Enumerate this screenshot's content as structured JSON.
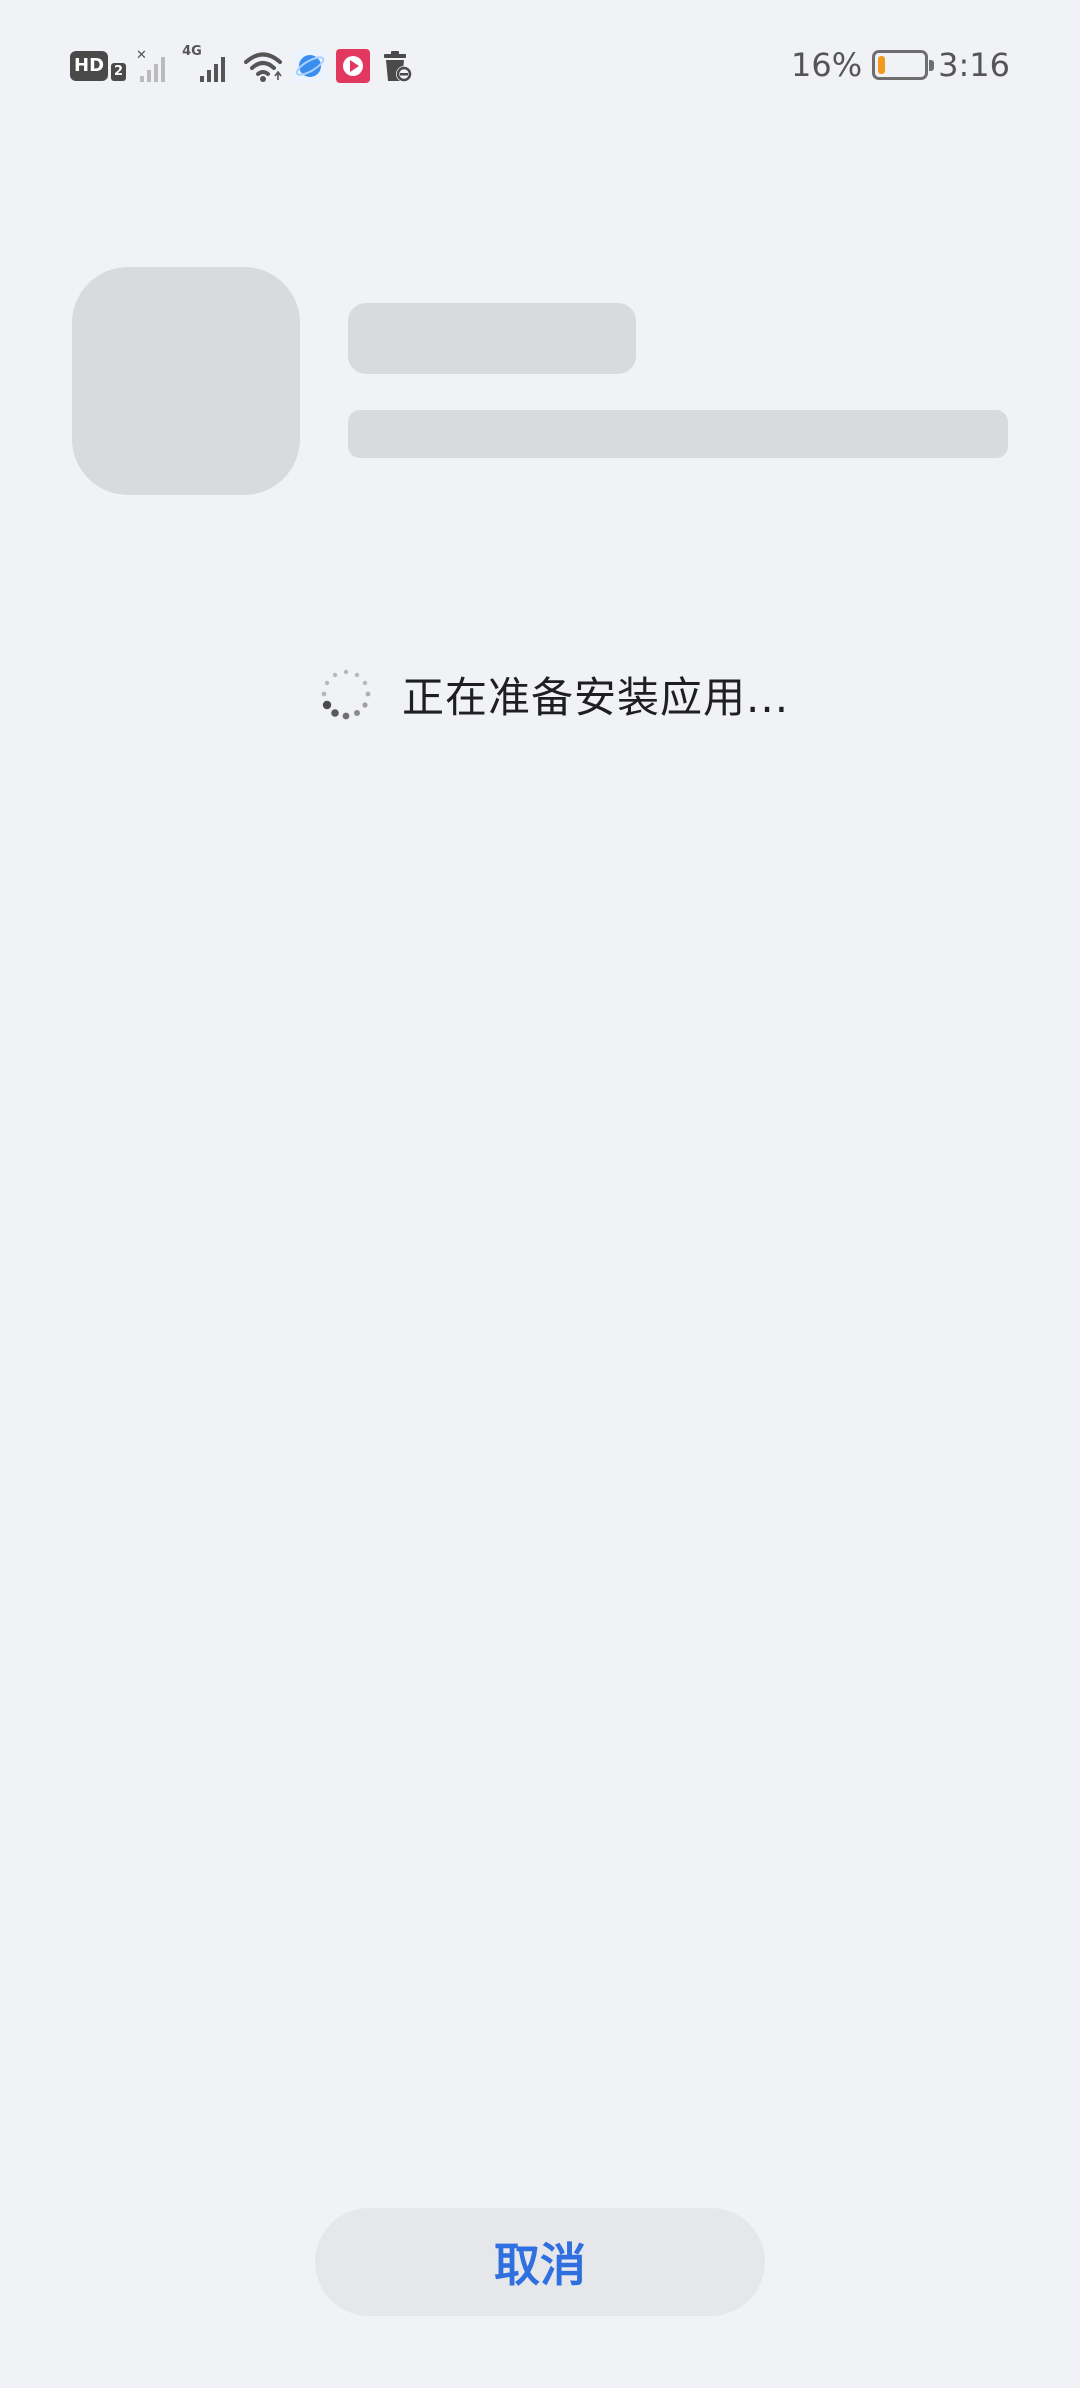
{
  "status_bar": {
    "hd_label": "HD",
    "hd_sub": "2",
    "network_label": "4G",
    "battery_percent_text": "16%",
    "battery_level": 0.16,
    "battery_color": "#f29a1f",
    "time": "3:16",
    "icons": [
      "hd-icon",
      "signal-no-service-icon",
      "signal-4g-icon",
      "wifi-icon",
      "browser-app-icon",
      "video-app-icon",
      "trash-cleaner-icon",
      "battery-icon"
    ]
  },
  "installer": {
    "status_text": "正在准备安装应用...",
    "cancel_label": "取消",
    "accent_color": "#2f6fe0"
  }
}
